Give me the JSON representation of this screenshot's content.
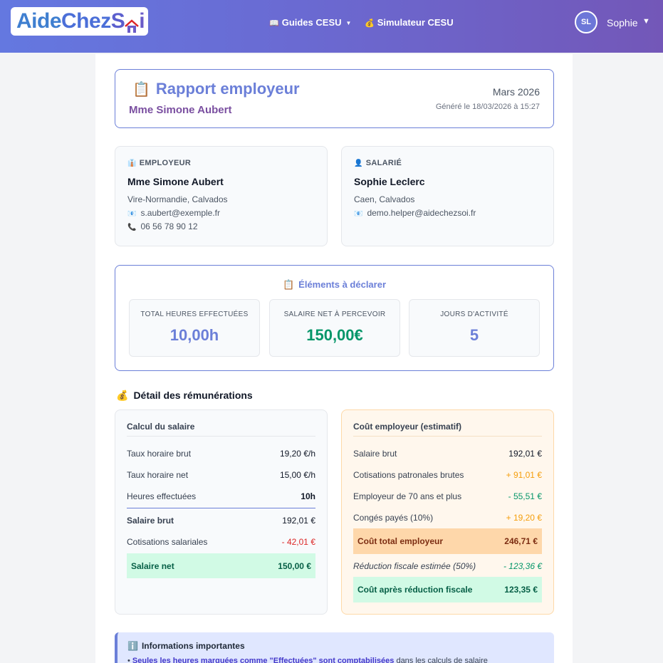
{
  "header": {
    "logo": "AideChezSoi",
    "nav": [
      {
        "icon": "📖",
        "label": "Guides CESU",
        "has_dropdown": true
      },
      {
        "icon": "💰",
        "label": "Simulateur CESU",
        "has_dropdown": false
      }
    ],
    "user": {
      "initials": "SL",
      "name": "Sophie"
    }
  },
  "report": {
    "icon": "📋",
    "title": "Rapport employeur",
    "subtitle": "Mme Simone Aubert",
    "period": "Mars 2026",
    "generated": "Généré le 18/03/2026 à 15:27"
  },
  "employer": {
    "icon": "👔",
    "label": "EMPLOYEUR",
    "name": "Mme Simone Aubert",
    "location": "Vire-Normandie, Calvados",
    "email": "s.aubert@exemple.fr",
    "phone": "06 56 78 90 12"
  },
  "employee": {
    "icon": "👤",
    "label": "SALARIÉ",
    "name": "Sophie Leclerc",
    "location": "Caen, Calvados",
    "email": "demo.helper@aidechezsoi.fr"
  },
  "declare": {
    "icon": "📋",
    "title": "Éléments à déclarer",
    "stats": [
      {
        "label": "TOTAL HEURES EFFECTUÉES",
        "value": "10,00h",
        "color": "#6b7fd8"
      },
      {
        "label": "SALAIRE NET À PERCEVOIR",
        "value": "150,00€",
        "color": "#059669"
      },
      {
        "label": "JOURS D'ACTIVITÉ",
        "value": "5",
        "color": "#6b7fd8"
      }
    ]
  },
  "detail": {
    "icon": "💰",
    "title": "Détail des rémunérations",
    "salary": {
      "title": "Calcul du salaire",
      "rows": [
        {
          "label": "Taux horaire brut",
          "value": "19,20 €/h"
        },
        {
          "label": "Taux horaire net",
          "value": "15,00 €/h"
        },
        {
          "label": "Heures effectuées",
          "value": "10h"
        },
        {
          "label": "Salaire brut",
          "value": "192,01 €"
        },
        {
          "label": "Cotisations salariales",
          "value": "- 42,01 €"
        },
        {
          "label": "Salaire net",
          "value": "150,00 €"
        }
      ]
    },
    "cost": {
      "title": "Coût employeur (estimatif)",
      "rows": [
        {
          "label": "Salaire brut",
          "value": "192,01 €"
        },
        {
          "label": "Cotisations patronales brutes",
          "value": "+ 91,01 €"
        },
        {
          "label": "Employeur de 70 ans et plus",
          "value": "- 55,51 €"
        },
        {
          "label": "Congés payés (10%)",
          "value": "+ 19,20 €"
        },
        {
          "label": "Coût total employeur",
          "value": "246,71 €"
        },
        {
          "label": "Réduction fiscale estimée (50%)",
          "value": "- 123,36 €"
        },
        {
          "label": "Coût après réduction fiscale",
          "value": "123,35 €"
        }
      ]
    }
  },
  "info": {
    "icon": "ℹ️",
    "title": "Informations importantes",
    "line_bold": "Seules les heures marquées comme \"Effectuées\" sont comptabilisées",
    "line_rest": " dans les calculs de salaire"
  }
}
